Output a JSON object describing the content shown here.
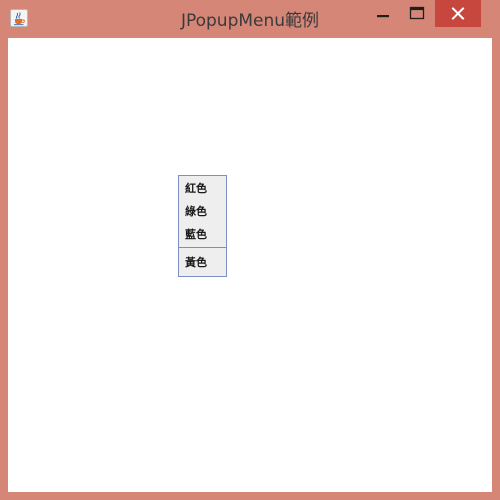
{
  "window": {
    "title": "JPopupMenu範例",
    "icon": "java-cup-icon",
    "controls": {
      "minimize_icon": "minimize-icon",
      "maximize_icon": "maximize-icon",
      "close_icon": "close-icon"
    },
    "frame_color": "#d58677",
    "close_button_color": "#c7463d"
  },
  "popup_menu": {
    "items": [
      {
        "label": "紅色"
      },
      {
        "label": "綠色"
      },
      {
        "label": "藍色"
      },
      {
        "label": "黃色"
      }
    ],
    "border_color": "#7a8fc4",
    "background_color": "#eeeeee"
  }
}
